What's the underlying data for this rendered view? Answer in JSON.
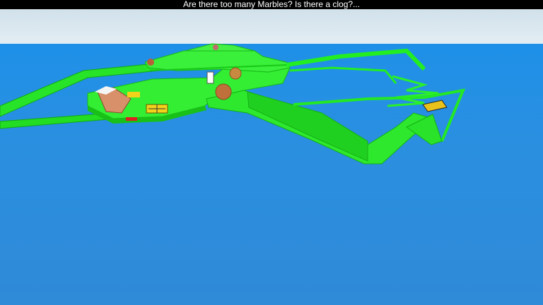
{
  "message_bar": {
    "text": "Are there too many Marbles? Is there a clog?..."
  },
  "colors": {
    "sky": "#d6e4ec",
    "sea": "#2b8fe0",
    "track": "#22ee22",
    "track_dark": "#14b814",
    "marble": "#c0703a",
    "accent_yellow": "#f3d21b",
    "accent_red": "#e02020"
  }
}
